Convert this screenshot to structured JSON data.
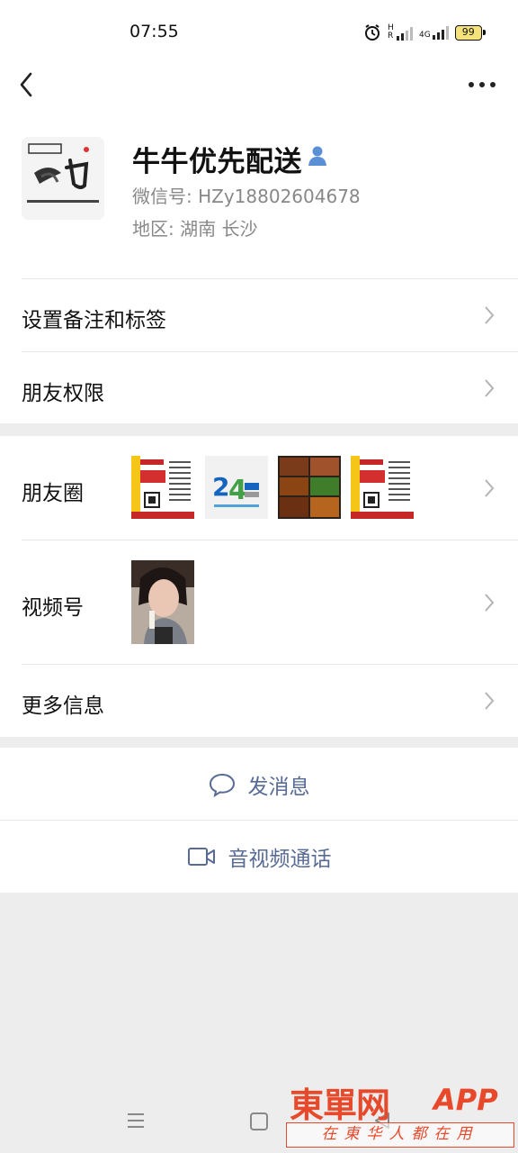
{
  "status_bar": {
    "time": "07:55",
    "network": "4G",
    "signal_label": "HR",
    "battery": "99"
  },
  "header": {
    "back_icon": "back-chevron-icon",
    "more_icon": "more-dots-icon"
  },
  "profile": {
    "name": "牛牛优先配送",
    "wechat_id": "微信号:  HZy18802604678",
    "region": "地区:  湖南  长沙",
    "verify_icon": "person-icon"
  },
  "rows": {
    "remark": "设置备注和标签",
    "permissions": "朋友权限",
    "moments": "朋友圈",
    "channels": "视频号",
    "more_info": "更多信息"
  },
  "actions": {
    "message": "发消息",
    "call": "音视频通话"
  },
  "colors": {
    "link_blue": "#576b95",
    "background": "#ededed",
    "watermark_red": "#e8492b"
  },
  "watermark": {
    "title": "東單网",
    "app": "APP",
    "subtitle": "在東华人都在用"
  }
}
